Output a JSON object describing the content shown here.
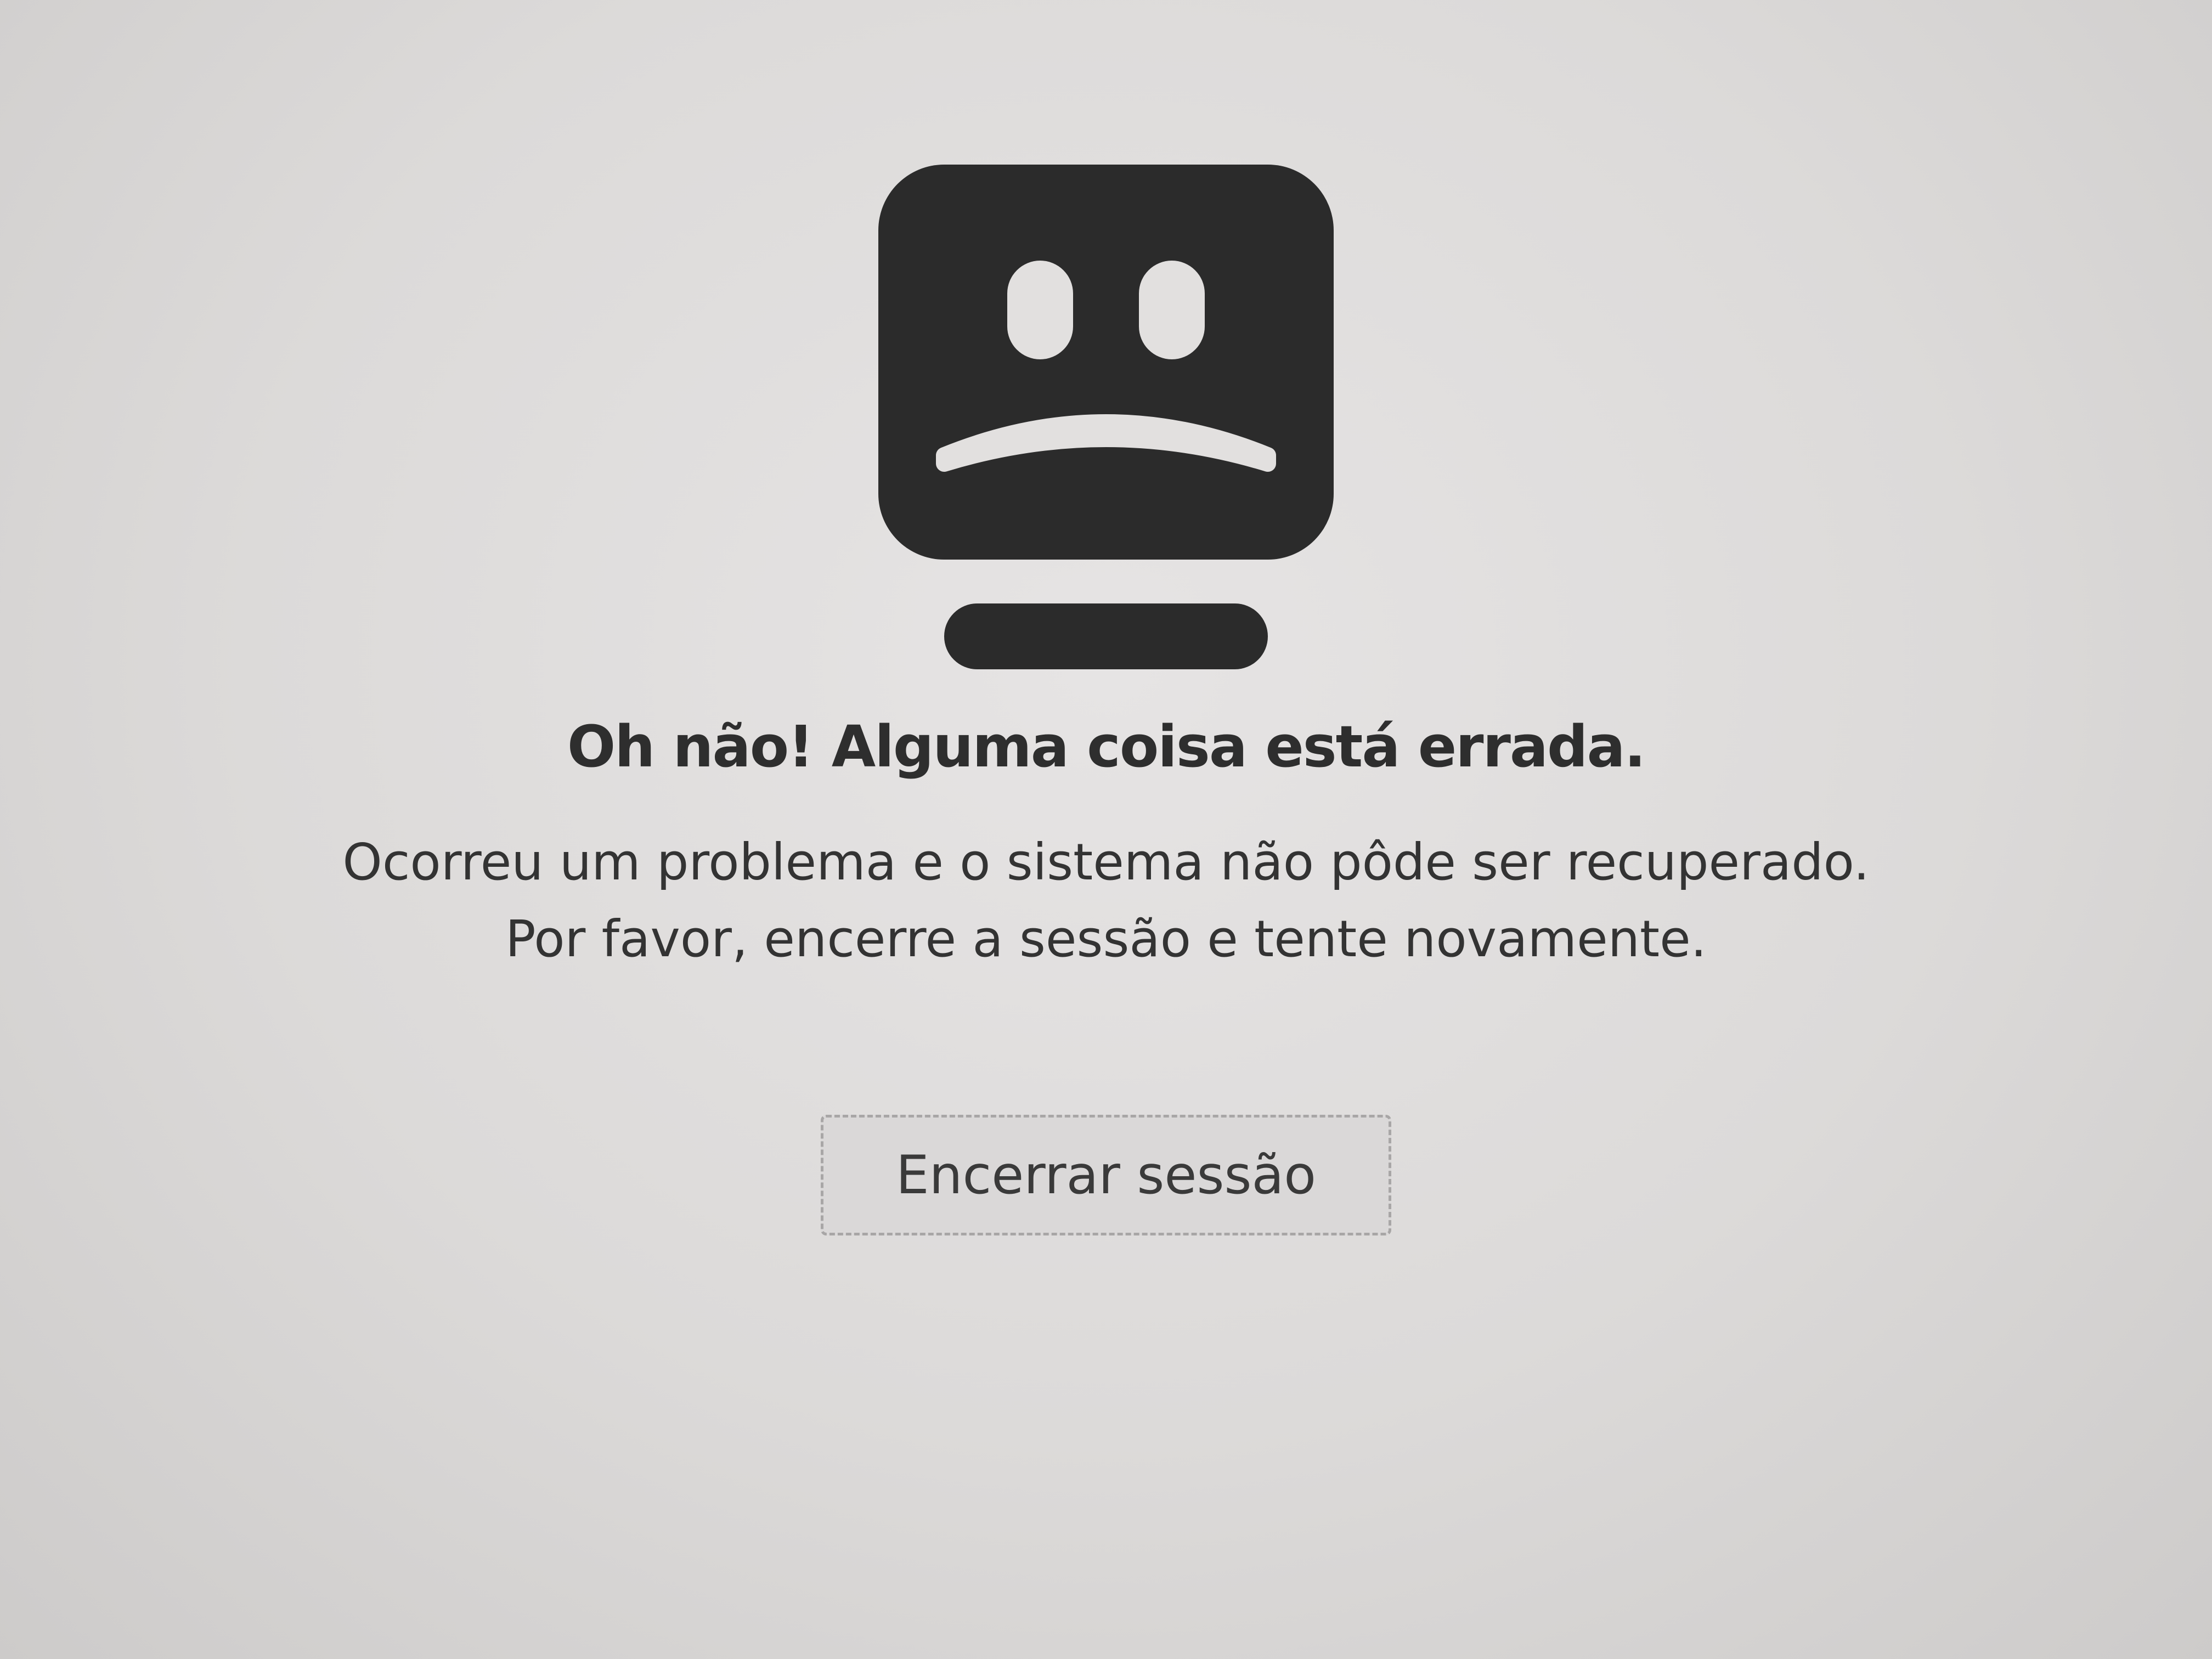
{
  "error_screen": {
    "icon": "sad-computer-face-icon",
    "title": "Oh não! Alguma coisa está errada.",
    "message_line1": "Ocorreu um problema e o sistema não pôde ser recuperado.",
    "message_line2": "Por favor, encerre a sessão e tente novamente.",
    "logout_button_label": "Encerrar sessão"
  },
  "colors": {
    "background": "#dcdad9",
    "icon": "#2b2b2b",
    "text": "#2e2e2e"
  }
}
